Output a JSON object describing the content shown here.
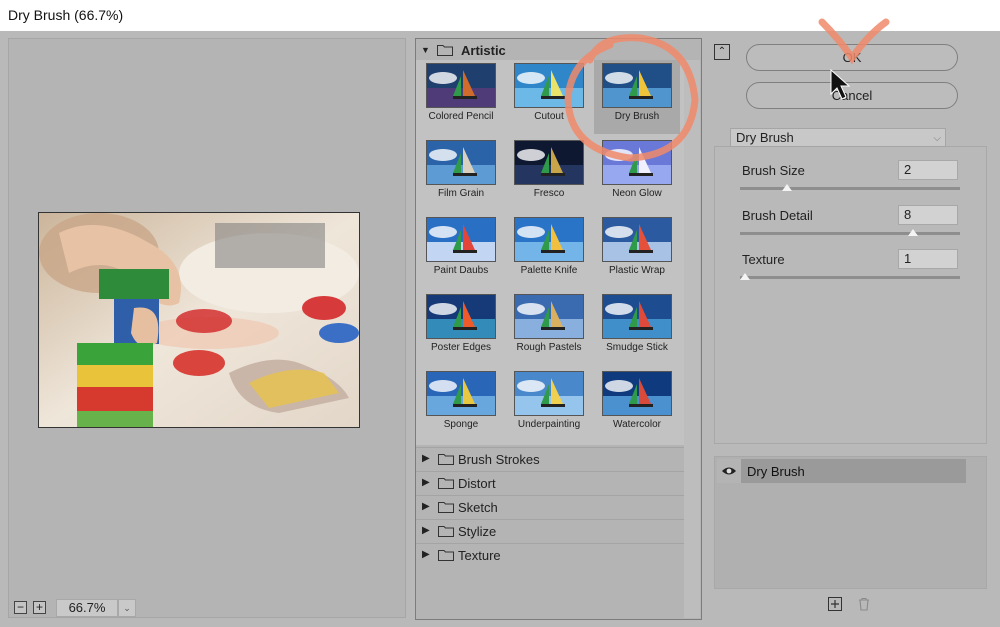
{
  "window": {
    "title": "Dry Brush (66.7%)"
  },
  "preview": {
    "zoom": "66.7%",
    "zoom_out_label": "−",
    "zoom_in_label": "+",
    "zoom_menu_glyph": "⌄"
  },
  "gallery": {
    "open_category": "Artistic",
    "filters": [
      {
        "label": "Colored Pencil"
      },
      {
        "label": "Cutout"
      },
      {
        "label": "Dry Brush",
        "selected": true
      },
      {
        "label": "Film Grain"
      },
      {
        "label": "Fresco"
      },
      {
        "label": "Neon Glow"
      },
      {
        "label": "Paint Daubs"
      },
      {
        "label": "Palette Knife"
      },
      {
        "label": "Plastic Wrap"
      },
      {
        "label": "Poster Edges"
      },
      {
        "label": "Rough Pastels"
      },
      {
        "label": "Smudge Stick"
      },
      {
        "label": "Sponge"
      },
      {
        "label": "Underpainting"
      },
      {
        "label": "Watercolor"
      }
    ],
    "categories": [
      "Brush Strokes",
      "Distort",
      "Sketch",
      "Stylize",
      "Texture"
    ]
  },
  "buttons": {
    "ok": "OK",
    "cancel": "Cancel",
    "collapse_glyph": "⌃"
  },
  "settings": {
    "filter_select": "Dry Brush",
    "params": [
      {
        "label": "Brush Size",
        "value": "2",
        "fraction": 0.2
      },
      {
        "label": "Brush Detail",
        "value": "8",
        "fraction": 0.8
      },
      {
        "label": "Texture",
        "value": "1",
        "fraction": 0.0
      }
    ]
  },
  "layers": {
    "items": [
      {
        "label": "Dry Brush"
      }
    ]
  },
  "colors": {
    "annotation": "#f08a6a",
    "dialog_bg": "#b9b9b9"
  }
}
